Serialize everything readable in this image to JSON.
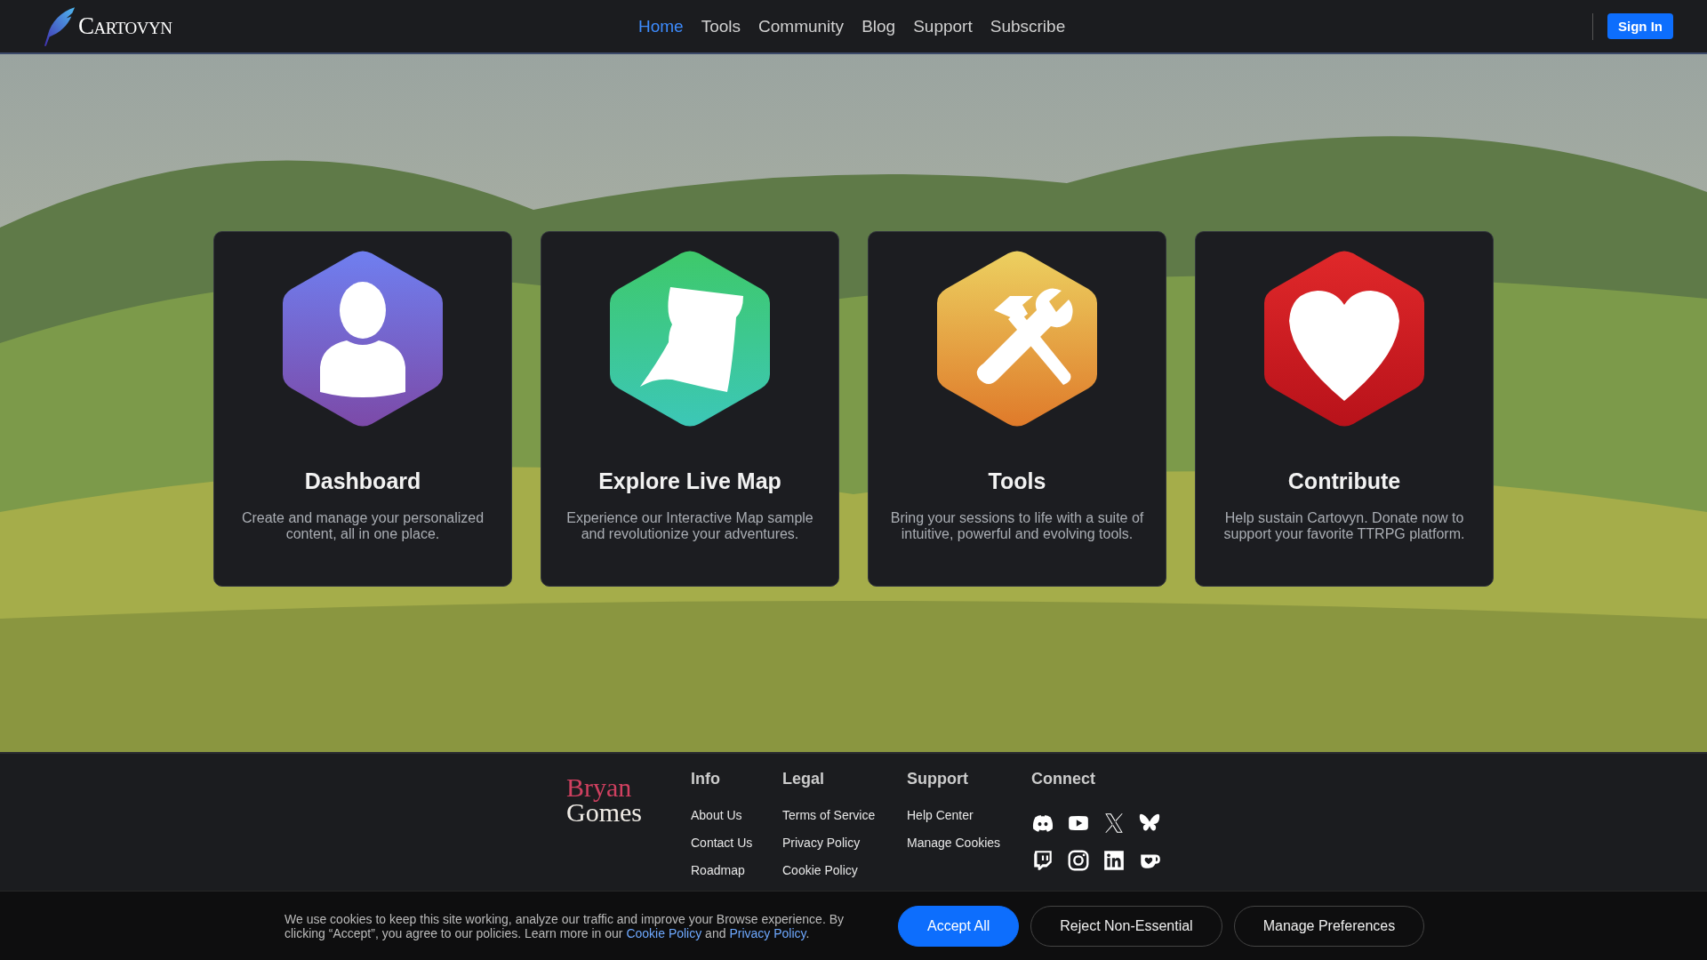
{
  "header": {
    "brand": "Cartovyn",
    "nav": [
      {
        "label": "Home",
        "selected": true
      },
      {
        "label": "Tools",
        "selected": false
      },
      {
        "label": "Community",
        "selected": false
      },
      {
        "label": "Blog",
        "selected": false
      },
      {
        "label": "Support",
        "selected": false
      },
      {
        "label": "Subscribe",
        "selected": false
      }
    ],
    "sign_in": "Sign In"
  },
  "cards": [
    {
      "kind": "person",
      "title": "Dashboard",
      "text": "Create and manage your personalized content, all in one place."
    },
    {
      "kind": "scroll",
      "title": "Explore Live Map",
      "text": "Experience our Interactive Map sample and revolutionize your adventures."
    },
    {
      "kind": "tools",
      "title": "Tools",
      "text": "Bring your sessions to life with a suite of intuitive, powerful and evolving tools."
    },
    {
      "kind": "heart",
      "title": "Contribute",
      "text": "Help sustain Cartovyn. Donate now to support your favorite TTRPG platform."
    }
  ],
  "footer": {
    "logo": [
      "Bryan",
      "Gomes"
    ],
    "columns": [
      {
        "title": "Info",
        "links": [
          "About Us",
          "Contact Us",
          "Roadmap"
        ]
      },
      {
        "title": "Legal",
        "links": [
          "Terms of Service",
          "Privacy Policy",
          "Cookie Policy"
        ]
      },
      {
        "title": "Support",
        "links": [
          "Help Center",
          "Manage Cookies"
        ]
      }
    ],
    "connect": {
      "title": "Connect",
      "icons": [
        {
          "kind": "discord"
        },
        {
          "kind": "youtube"
        },
        {
          "kind": "x"
        },
        {
          "kind": "bluesky"
        },
        {
          "kind": "twitch"
        },
        {
          "kind": "instagram"
        },
        {
          "kind": "linkedin"
        },
        {
          "kind": "kofi"
        }
      ]
    }
  },
  "cookie_banner": {
    "text_before": "We use cookies to keep this site working, analyze our traffic and improve your Browse experience. By clicking “Accept”, you agree to our policies. Learn more in our",
    "link1": "Cookie Policy",
    "text_middle": "and",
    "link2": "Privacy Policy",
    "text_after": ".",
    "buttons": [
      {
        "kind": "primary",
        "label": "Accept All"
      },
      {
        "kind": "outline",
        "label": "Reject Non-Essential"
      },
      {
        "kind": "outline",
        "label": "Manage Preferences"
      }
    ]
  }
}
